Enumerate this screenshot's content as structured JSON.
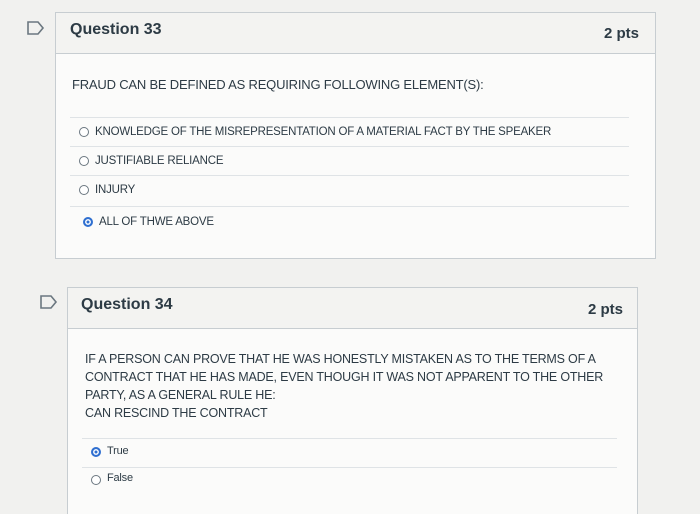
{
  "questions": [
    {
      "title": "Question 33",
      "points": "2 pts",
      "text": "FRAUD CAN BE DEFINED AS REQUIRING FOLLOWING ELEMENT(S):",
      "options": [
        {
          "label": "KNOWLEDGE OF THE MISREPRESENTATION OF A MATERIAL FACT BY THE SPEAKER",
          "selected": false
        },
        {
          "label": "JUSTIFIABLE RELIANCE",
          "selected": false
        },
        {
          "label": "INJURY",
          "selected": false
        },
        {
          "label": "ALL OF THWE ABOVE",
          "selected": true
        }
      ]
    },
    {
      "title": "Question 34",
      "points": "2 pts",
      "text_lines": [
        "IF A PERSON CAN PROVE THAT HE WAS HONESTLY MISTAKEN AS TO THE TERMS OF A",
        "CONTRACT THAT HE HAS MADE, EVEN THOUGH IT WAS NOT APPARENT TO THE OTHER",
        "PARTY, AS A GENERAL RULE HE:",
        "CAN RESCIND THE CONTRACT"
      ],
      "options": [
        {
          "label": "True",
          "selected": true
        },
        {
          "label": "False",
          "selected": false
        }
      ]
    }
  ],
  "colors": {
    "accent": "#2f6fd0",
    "text": "#2d3b45",
    "border": "#c7cdd1"
  },
  "icons": {
    "flag": "flag-icon"
  }
}
